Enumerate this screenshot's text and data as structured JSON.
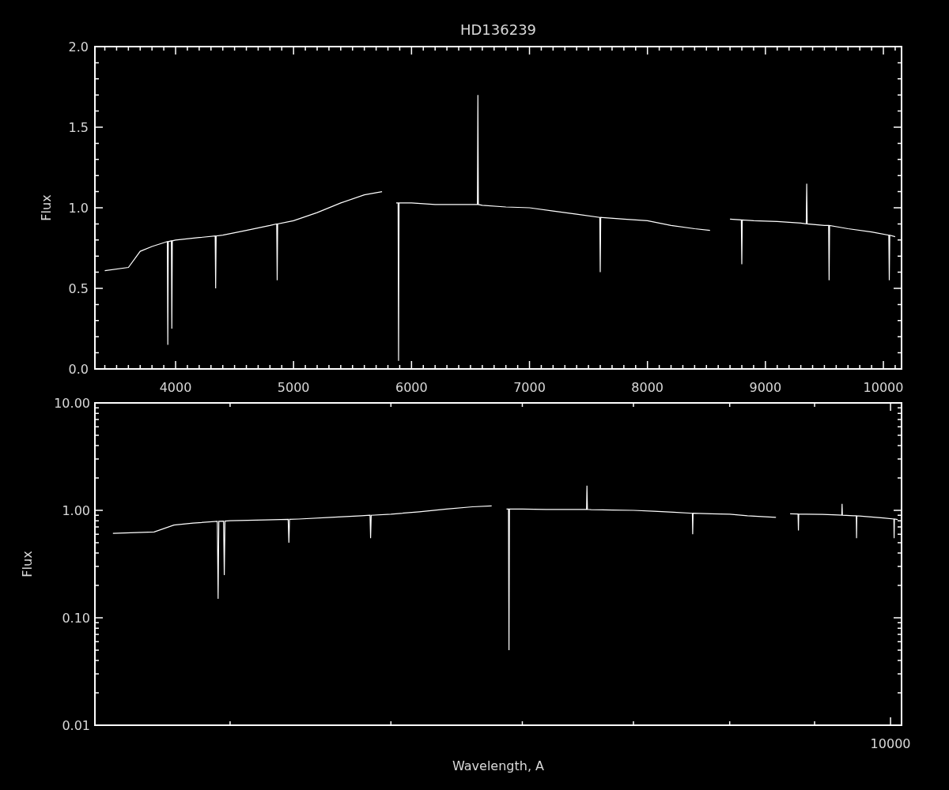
{
  "linear_panel": {
    "chart_data": {
      "type": "line",
      "title": "HD136239",
      "ylabel": "Flux",
      "xlim": [
        3316,
        10154
      ],
      "ylim": [
        0,
        2
      ],
      "xticks": [
        4000,
        5000,
        6000,
        7000,
        8000,
        9000,
        10000
      ],
      "yticks": [
        {
          "value": 0,
          "label": "0.0"
        },
        {
          "value": 0.5,
          "label": "0.5"
        },
        {
          "value": 1,
          "label": "1.0"
        },
        {
          "value": 1.5,
          "label": "1.5"
        },
        {
          "value": 2,
          "label": "2.0"
        }
      ],
      "x": [
        3400,
        3600,
        3700,
        3800,
        3930,
        3934,
        3938,
        3964,
        3968,
        3972,
        4000,
        4200,
        4336,
        4340,
        4344,
        4400,
        4600,
        4800,
        4857,
        4861,
        4865,
        5000,
        5200,
        5400,
        5600,
        5750,
        5870,
        5886,
        5890,
        5894,
        6000,
        6200,
        6400,
        6559,
        6563,
        6567,
        6600,
        6800,
        7000,
        7200,
        7400,
        7596,
        7600,
        7604,
        7800,
        8000,
        8200,
        8400,
        8530,
        8700,
        8796,
        8800,
        8804,
        8900,
        9100,
        9300,
        9346,
        9350,
        9354,
        9500,
        9536,
        9540,
        9544,
        9700,
        9900,
        10046,
        10050,
        10054,
        10100
      ],
      "series": [
        {
          "color": "#ffffff",
          "values": [
            0.61,
            0.63,
            0.73,
            0.76,
            0.79,
            0.15,
            0.79,
            0.795,
            0.25,
            0.795,
            0.8,
            0.815,
            0.825,
            0.5,
            0.825,
            0.83,
            0.86,
            0.89,
            0.9,
            0.55,
            0.9,
            0.92,
            0.97,
            1.03,
            1.08,
            1.1,
            null,
            null,
            null,
            null,
            null,
            null,
            null,
            null,
            null,
            null,
            null,
            null,
            null,
            null,
            null,
            null,
            null,
            null,
            null,
            null,
            null,
            null,
            null,
            null,
            null,
            null,
            null,
            null,
            null,
            null,
            null,
            null,
            null,
            null,
            null,
            null,
            null,
            null,
            null,
            null,
            null,
            null,
            null
          ]
        },
        {
          "color": "#ffffff",
          "values": [
            null,
            null,
            null,
            null,
            null,
            null,
            null,
            null,
            null,
            null,
            null,
            null,
            null,
            null,
            null,
            null,
            null,
            null,
            null,
            null,
            null,
            null,
            null,
            null,
            null,
            null,
            1.03,
            1.03,
            0.05,
            1.03,
            1.03,
            1.02,
            1.02,
            1.02,
            1.7,
            1.02,
            1.015,
            1.005,
            1.0,
            0.98,
            0.96,
            0.94,
            0.6,
            0.94,
            0.93,
            0.92,
            0.89,
            0.87,
            0.86,
            null,
            null,
            null,
            null,
            null,
            null,
            null,
            null,
            null,
            null,
            null,
            null,
            null,
            null,
            null,
            null,
            null,
            null,
            null,
            null
          ]
        },
        {
          "color": "#ffffff",
          "values": [
            null,
            null,
            null,
            null,
            null,
            null,
            null,
            null,
            null,
            null,
            null,
            null,
            null,
            null,
            null,
            null,
            null,
            null,
            null,
            null,
            null,
            null,
            null,
            null,
            null,
            null,
            null,
            null,
            null,
            null,
            null,
            null,
            null,
            null,
            null,
            null,
            null,
            null,
            null,
            null,
            null,
            null,
            null,
            null,
            null,
            null,
            null,
            null,
            null,
            0.93,
            0.925,
            0.65,
            0.925,
            0.92,
            0.915,
            0.905,
            0.9,
            1.15,
            0.9,
            0.89,
            0.89,
            0.55,
            0.89,
            0.87,
            0.85,
            0.83,
            0.55,
            0.83,
            0.82
          ]
        }
      ]
    }
  },
  "log_panel": {
    "ylabel": "Flux",
    "yticks": [
      "10.00",
      "1.00",
      "0.10",
      "0.01"
    ],
    "xticks": [
      "10000"
    ],
    "xlabel": "Wavelength, A"
  }
}
